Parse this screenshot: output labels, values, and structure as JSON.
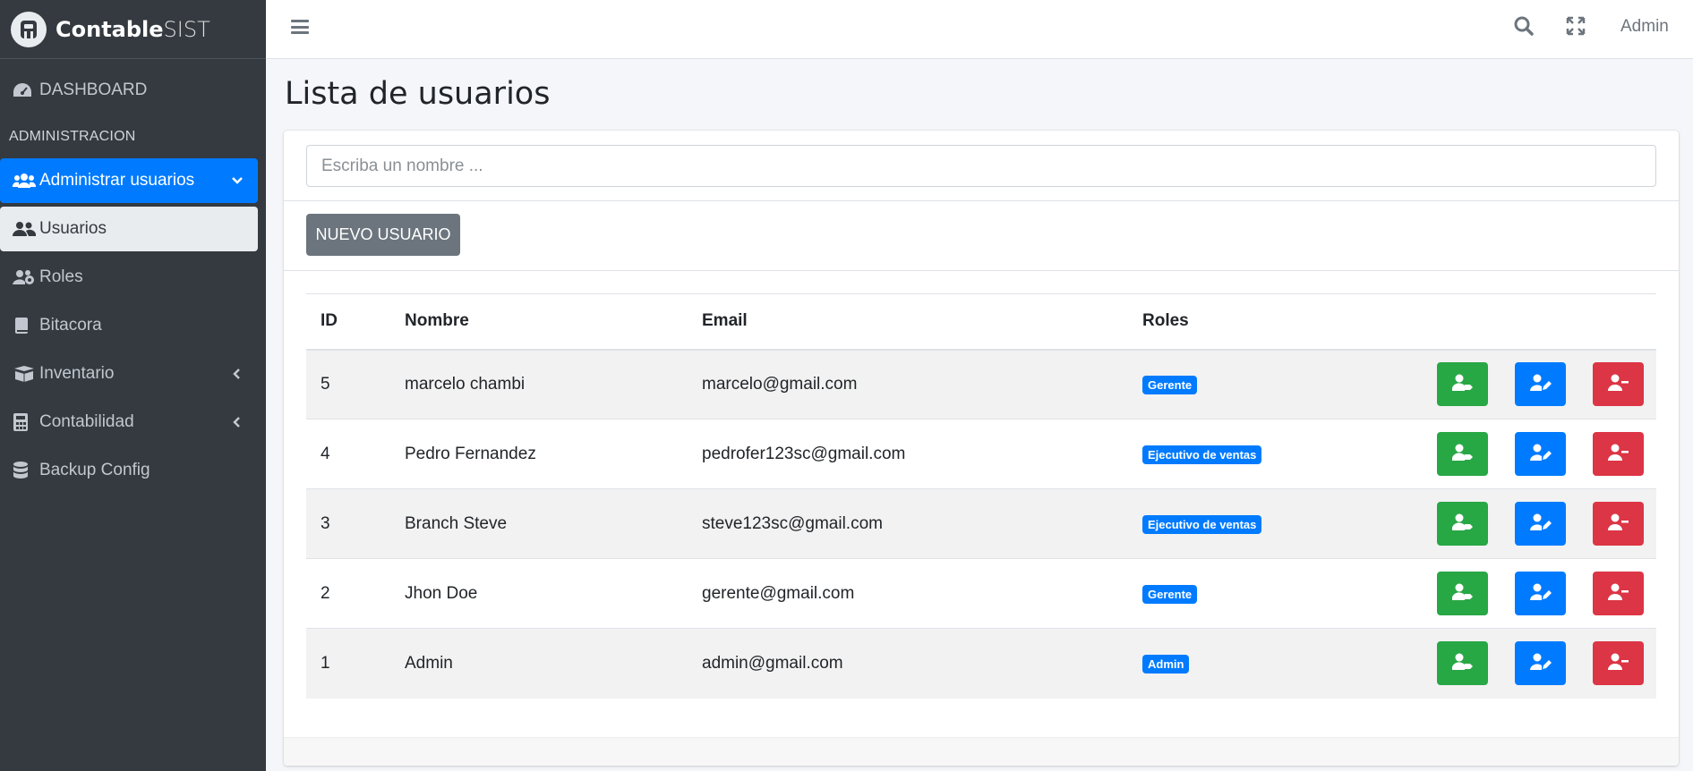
{
  "brand": {
    "bold": "Contable",
    "light": "SIST"
  },
  "sidebar": {
    "dashboard": "DASHBOARD",
    "section_header": "ADMINISTRACION",
    "admin_users": "Administrar usuarios",
    "usuarios": "Usuarios",
    "roles": "Roles",
    "bitacora": "Bitacora",
    "inventario": "Inventario",
    "contabilidad": "Contabilidad",
    "backup": "Backup Config"
  },
  "topbar": {
    "user": "Admin"
  },
  "page": {
    "title": "Lista de usuarios"
  },
  "search": {
    "placeholder": "Escriba un nombre ..."
  },
  "new_user_button": "NUEVO USUARIO",
  "table": {
    "headers": {
      "id": "ID",
      "name": "Nombre",
      "email": "Email",
      "roles": "Roles"
    },
    "rows": [
      {
        "id": "5",
        "name": "marcelo chambi",
        "email": "marcelo@gmail.com",
        "role": "Gerente"
      },
      {
        "id": "4",
        "name": "Pedro Fernandez",
        "email": "pedrofer123sc@gmail.com",
        "role": "Ejecutivo de ventas"
      },
      {
        "id": "3",
        "name": "Branch Steve",
        "email": "steve123sc@gmail.com",
        "role": "Ejecutivo de ventas"
      },
      {
        "id": "2",
        "name": "Jhon Doe",
        "email": "gerente@gmail.com",
        "role": "Gerente"
      },
      {
        "id": "1",
        "name": "Admin",
        "email": "admin@gmail.com",
        "role": "Admin"
      }
    ]
  },
  "colors": {
    "sidebar_bg": "#343a40",
    "primary": "#007bff",
    "success": "#28a745",
    "danger": "#dc3545",
    "secondary": "#6c757d"
  }
}
